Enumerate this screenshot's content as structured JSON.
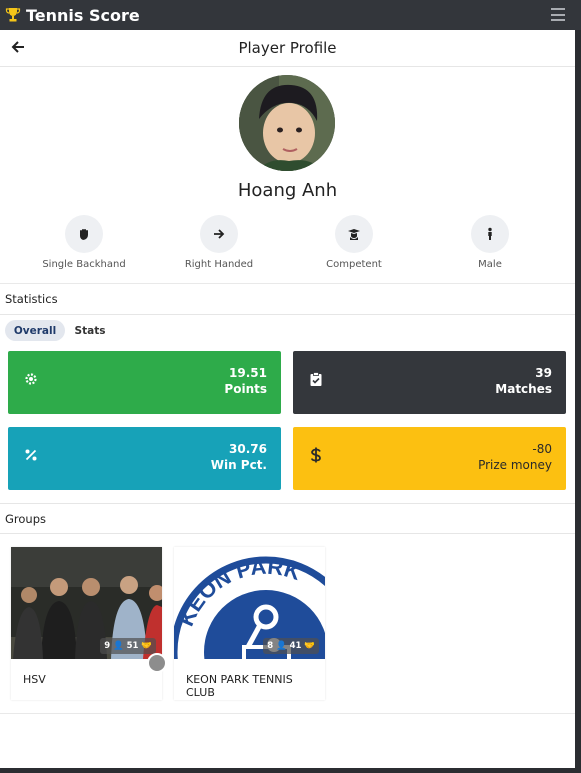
{
  "app": {
    "title": "Tennis Score",
    "trophy_icon": "trophy-icon",
    "menu_icon": "hamburger-menu-icon"
  },
  "header": {
    "title": "Player Profile",
    "back_icon": "arrow-left-icon"
  },
  "player": {
    "name": "Hoang Anh",
    "attributes": [
      {
        "label": "Single Backhand",
        "icon": "hand-icon"
      },
      {
        "label": "Right Handed",
        "icon": "arrow-right-icon"
      },
      {
        "label": "Competent",
        "icon": "graduate-icon"
      },
      {
        "label": "Male",
        "icon": "male-icon"
      }
    ]
  },
  "statistics": {
    "heading": "Statistics",
    "tabs": [
      "Overall",
      "Stats"
    ],
    "active_tab": "Overall",
    "cards": [
      {
        "value": "19.51",
        "label": "Points",
        "icon": "gear-icon",
        "color": "#2eab4a"
      },
      {
        "value": "39",
        "label": "Matches",
        "icon": "clipboard-check-icon",
        "color": "#34373c"
      },
      {
        "value": "30.76",
        "label": "Win Pct.",
        "icon": "percent-icon",
        "color": "#17a2b8"
      },
      {
        "value": "-80",
        "label": "Prize money",
        "icon": "dollar-icon",
        "color": "#fcc011"
      }
    ]
  },
  "groups": {
    "heading": "Groups",
    "items": [
      {
        "name": "HSV",
        "badge": "9 👤 51 🤝"
      },
      {
        "name": "KEON PARK TENNIS CLUB",
        "badge": "8 👤 41 🤝",
        "logo_text": "KEON PARK"
      }
    ]
  },
  "colors": {
    "accent": "#1f3a6a",
    "topbar": "#33363b"
  }
}
